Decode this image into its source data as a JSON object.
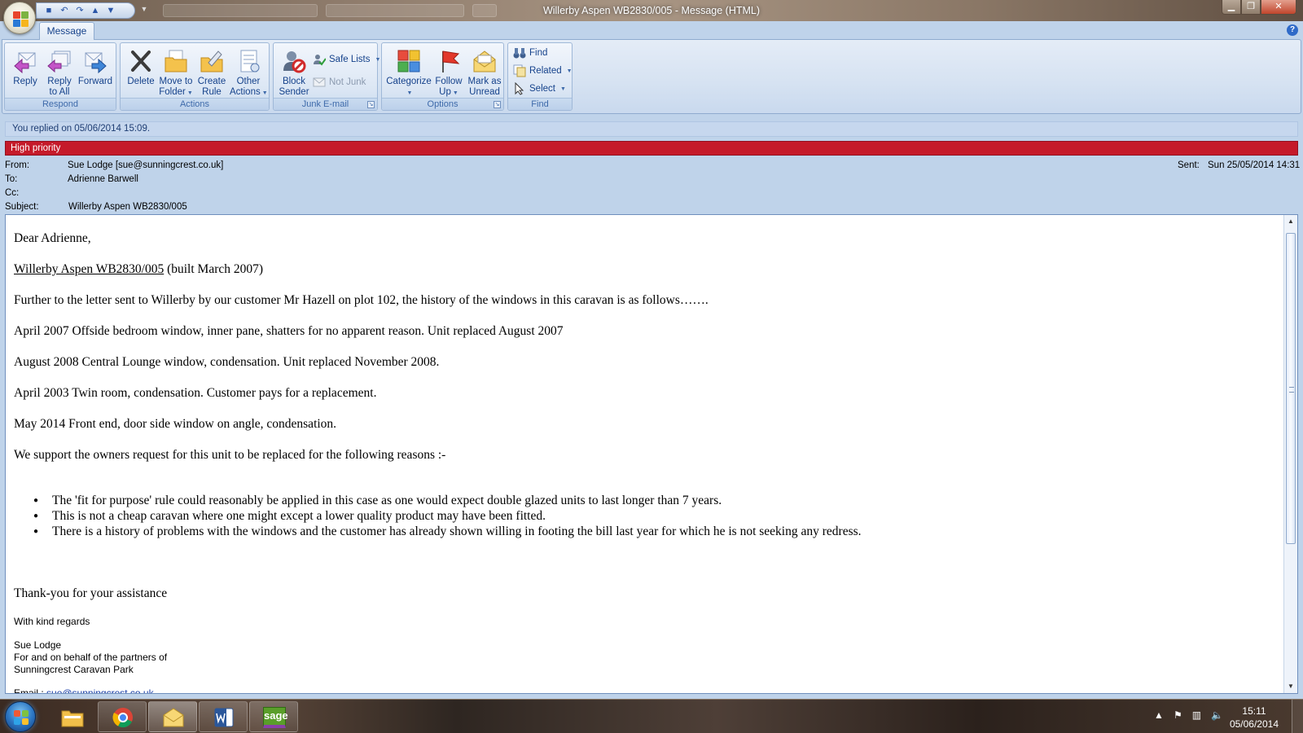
{
  "window": {
    "title": "Willerby Aspen WB2830/005 - Message (HTML)",
    "min_glyph": "▁",
    "restore_glyph": "❐",
    "close_glyph": "✕"
  },
  "ribbon": {
    "tab": "Message",
    "help_glyph": "?",
    "groups": {
      "respond": "Respond",
      "actions": "Actions",
      "junk": "Junk E-mail",
      "options": "Options",
      "find": "Find"
    },
    "buttons": {
      "reply": "Reply",
      "reply_all_1": "Reply",
      "reply_all_2": "to All",
      "forward": "Forward",
      "delete": "Delete",
      "move_1": "Move to",
      "move_2": "Folder",
      "create_1": "Create",
      "create_2": "Rule",
      "other_1": "Other",
      "other_2": "Actions",
      "block_1": "Block",
      "block_2": "Sender",
      "safe_lists": "Safe Lists",
      "not_junk": "Not Junk",
      "categorize": "Categorize",
      "follow_1": "Follow",
      "follow_2": "Up",
      "mark_1": "Mark as",
      "mark_2": "Unread",
      "find": "Find",
      "related": "Related",
      "select": "Select"
    }
  },
  "info": {
    "replied": "You replied on 05/06/2014 15:09.",
    "priority": "High priority"
  },
  "header": {
    "from_label": "From:",
    "from": "Sue Lodge [sue@sunningcrest.co.uk]",
    "to_label": "To:",
    "to": "Adrienne Barwell",
    "cc_label": "Cc:",
    "cc": "",
    "subject_label": "Subject:",
    "subject": "Willerby Aspen WB2830/005",
    "sent_label": "Sent:",
    "sent": "Sun 25/05/2014 14:31"
  },
  "body": {
    "greeting": "Dear Adrienne,",
    "ref_link": "Willerby Aspen WB2830/005",
    "ref_rest": " (built March 2007)",
    "p1": "Further to the letter sent to Willerby by our customer Mr Hazell on plot 102, the history of the windows in this caravan is as follows…….",
    "p2": "April 2007 Offside bedroom window, inner pane, shatters for no apparent reason. Unit replaced August 2007",
    "p3": "August 2008 Central Lounge window, condensation. Unit replaced November 2008.",
    "p4": "April 2003 Twin room, condensation. Customer pays for a replacement.",
    "p5": "May 2014 Front end, door side window on angle, condensation.",
    "p6": "We support the owners request for this unit to be replaced for the following reasons :-",
    "bullets": [
      "The 'fit for purpose' rule could reasonably be applied in this case as one would expect double glazed units to last longer than 7 years.",
      "This is not a cheap caravan where one might except a lower quality product may have been fitted.",
      "There is a history of problems with the windows and the customer has already shown willing in footing the bill last year for which he is not seeking any redress."
    ],
    "thanks": "Thank-you for your assistance",
    "regards": "With kind regards",
    "sig_name": "Sue Lodge",
    "sig_line2": "For and on behalf of the partners of",
    "sig_line3": "Sunningcrest Caravan Park",
    "email_label": "Email  :  ",
    "email": "sue@sunningcrest.co.uk"
  },
  "taskbar": {
    "time": "15:11",
    "date": "05/06/2014",
    "sage": "sage",
    "tray_up": "▲",
    "tray_flag": "⚑",
    "tray_net": "▥",
    "tray_vol": "🔈"
  }
}
